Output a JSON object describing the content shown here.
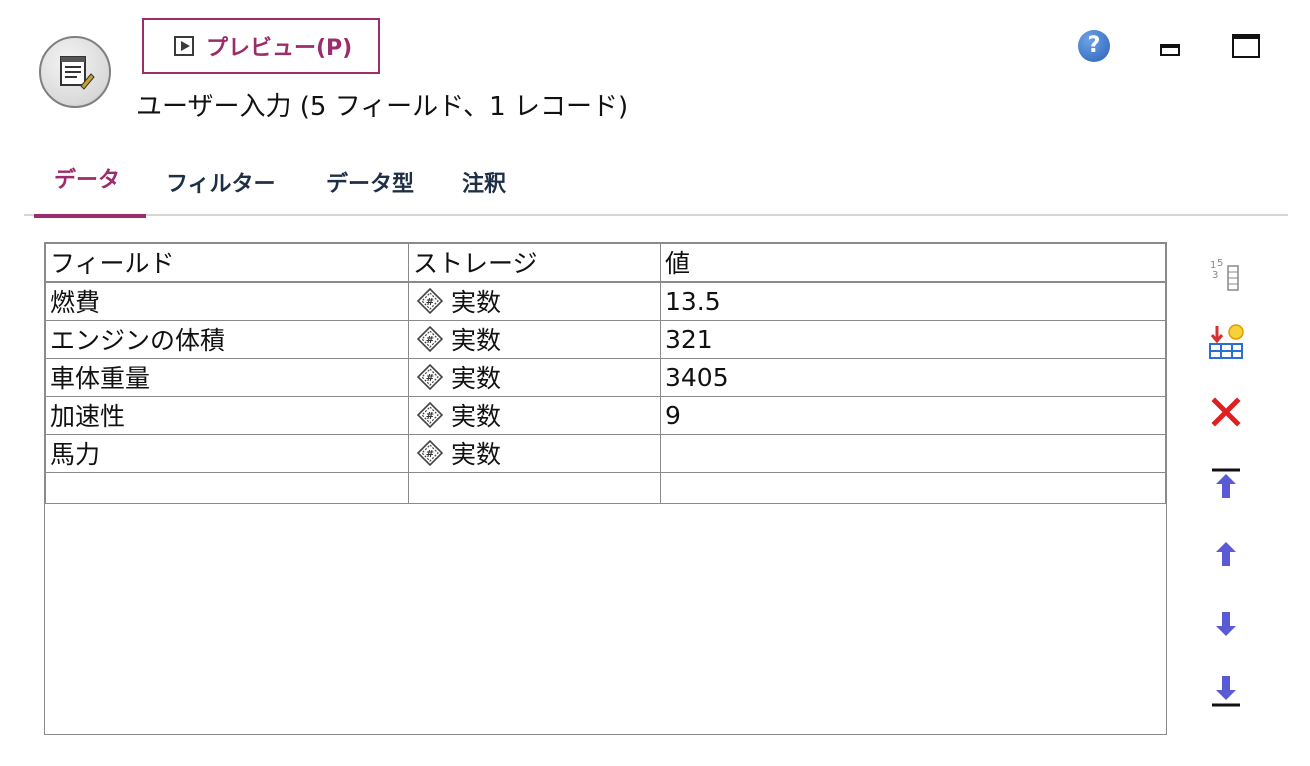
{
  "header": {
    "preview_label": "プレビュー(P)",
    "node_title": "ユーザー入力 (5 フィールド、1 レコード)",
    "help_glyph": "?"
  },
  "tabs": [
    {
      "label": "データ",
      "active": true
    },
    {
      "label": "フィルター",
      "active": false
    },
    {
      "label": "データ型",
      "active": false
    },
    {
      "label": "注釈",
      "active": false
    }
  ],
  "grid": {
    "columns": [
      "フィールド",
      "ストレージ",
      "値"
    ],
    "rows": [
      {
        "field": "燃費",
        "storage": "実数",
        "value": "13.5"
      },
      {
        "field": "エンジンの体積",
        "storage": "実数",
        "value": "321"
      },
      {
        "field": "車体重量",
        "storage": "実数",
        "value": "3405"
      },
      {
        "field": "加速性",
        "storage": "実数",
        "value": "9"
      },
      {
        "field": "馬力",
        "storage": "実数",
        "value": ""
      },
      {
        "field": "",
        "storage": "",
        "value": ""
      }
    ]
  },
  "toolbar": {
    "icons": [
      "number-format-icon",
      "import-fields-icon",
      "delete-icon",
      "move-to-top-icon",
      "move-up-icon",
      "move-down-icon",
      "move-to-bottom-icon"
    ]
  },
  "colors": {
    "accent": "#9b2d6b",
    "help_blue": "#2a61b8",
    "delete_red": "#e02020",
    "arrow_purple": "#5a5ad6"
  }
}
